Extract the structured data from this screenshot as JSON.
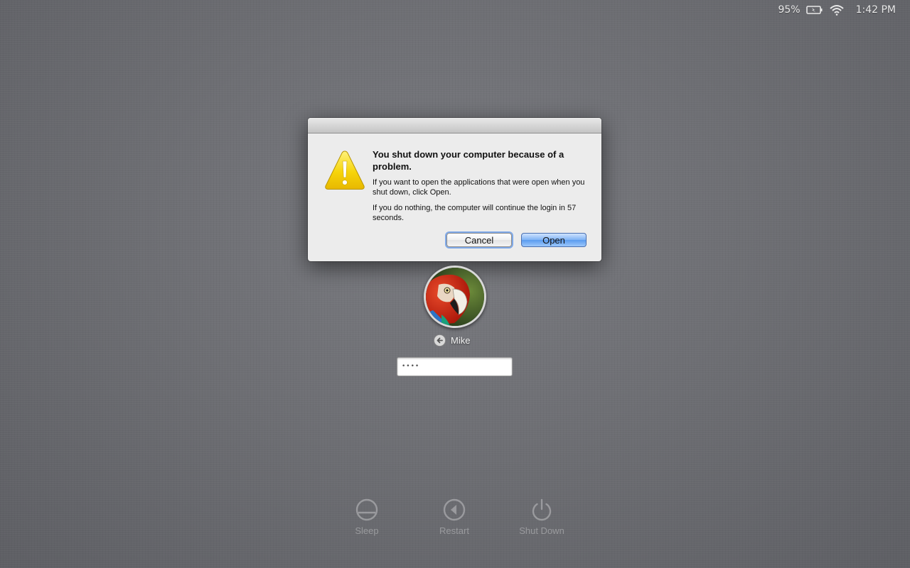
{
  "status_bar": {
    "battery_percent": "95%",
    "battery_icon": "battery-charging-icon",
    "wifi_icon": "wifi-icon",
    "time": "1:42 PM"
  },
  "dialog": {
    "icon": "warning-icon",
    "title": "You shut down your computer because of a problem.",
    "message_1": "If you want to open the applications that were open when you shut down, click Open.",
    "message_2": "If you do nothing, the computer will continue the login in 57 seconds.",
    "cancel_label": "Cancel",
    "open_label": "Open",
    "default_button_color": "#5a9bef"
  },
  "login": {
    "avatar_icon": "parrot-avatar",
    "back_icon": "back-arrow-icon",
    "username": "Mike",
    "password_value": "••••"
  },
  "power_actions": [
    {
      "label": "Sleep",
      "icon": "sleep-icon"
    },
    {
      "label": "Restart",
      "icon": "restart-icon"
    },
    {
      "label": "Shut Down",
      "icon": "power-icon"
    }
  ]
}
